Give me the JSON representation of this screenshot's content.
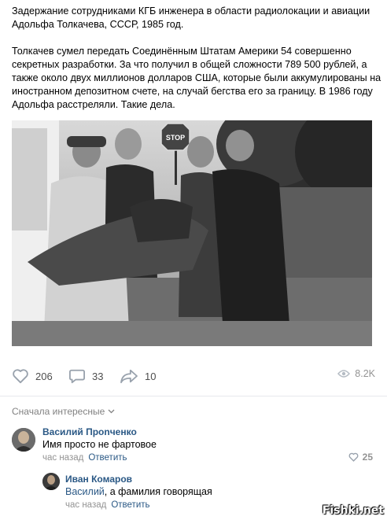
{
  "post": {
    "paragraph1": "Задержание сотрудниками КГБ инженера в области радиолокации и авиации Адольфа Толкачева, СССР, 1985 год.",
    "paragraph2": "Толкачев сумел передать Соединённым Штатам Америки 54 совершенно секретных разработки. За что получил в общей сложности 789 500 рублей, а также около двух миллионов долларов США, которые были аккумулированы на иностранном депозитном счете, на случай бегства его за границу. В 1986 году Адольфа расстреляли. Такие дела.",
    "photo_sign": "STOP"
  },
  "actions": {
    "likes": "206",
    "comments": "33",
    "shares": "10",
    "views": "8.2K"
  },
  "comments_section": {
    "sort_label": "Сначала интересные"
  },
  "comments": [
    {
      "author": "Василий Прonченко",
      "text": "Имя просто не фартовое",
      "time": "час назад",
      "reply_label": "Ответить",
      "likes": "25"
    },
    {
      "author": "Иван Комаров",
      "mention": "Василий",
      "text": ", а фамилия говорящая",
      "time": "час назад",
      "reply_label": "Ответить"
    }
  ],
  "watermark": "Fishki.net",
  "colors": {
    "link": "#2a5885",
    "meta": "#939393",
    "divider": "#e7e8ec"
  },
  "icons": [
    "heart-icon",
    "comment-icon",
    "share-icon",
    "eye-icon",
    "chevron-down-icon"
  ]
}
